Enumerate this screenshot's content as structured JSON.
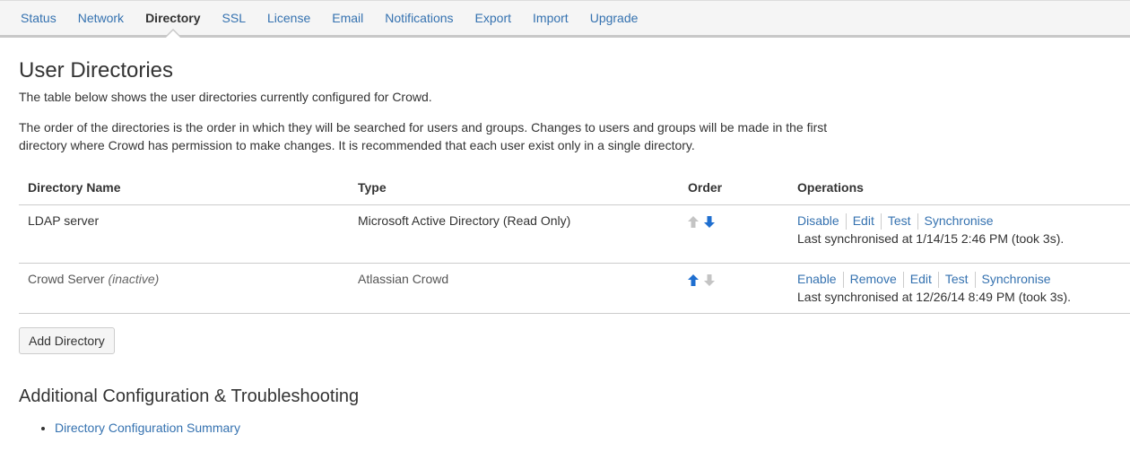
{
  "nav": {
    "items": [
      "Status",
      "Network",
      "Directory",
      "SSL",
      "License",
      "Email",
      "Notifications",
      "Export",
      "Import",
      "Upgrade"
    ],
    "active": "Directory"
  },
  "main": {
    "title": "User Directories",
    "intro": "The table below shows the user directories currently configured for Crowd.",
    "description": "The order of the directories is the order in which they will be searched for users and groups. Changes to users and groups will be made in the first directory where Crowd has permission to make changes. It is recommended that each user exist only in a single directory."
  },
  "table": {
    "headers": {
      "name": "Directory Name",
      "type": "Type",
      "order": "Order",
      "operations": "Operations"
    },
    "rows": [
      {
        "name": "LDAP server",
        "status": "",
        "type": "Microsoft Active Directory (Read Only)",
        "ops": [
          "Disable",
          "Edit",
          "Test",
          "Synchronise"
        ],
        "sync": "Last synchronised at 1/14/15 2:46 PM (took 3s)."
      },
      {
        "name": "Crowd Server",
        "status": "(inactive)",
        "type": "Atlassian Crowd",
        "ops": [
          "Enable",
          "Remove",
          "Edit",
          "Test",
          "Synchronise"
        ],
        "sync": "Last synchronised at 12/26/14 8:49 PM (took 3s)."
      }
    ]
  },
  "add_button": "Add Directory",
  "additional": {
    "title": "Additional Configuration & Troubleshooting",
    "links": [
      "Directory Configuration Summary"
    ]
  },
  "colors": {
    "link": "#3572b0",
    "arrow_active": "#1f6fd0",
    "arrow_disabled": "#b8b8b8"
  }
}
